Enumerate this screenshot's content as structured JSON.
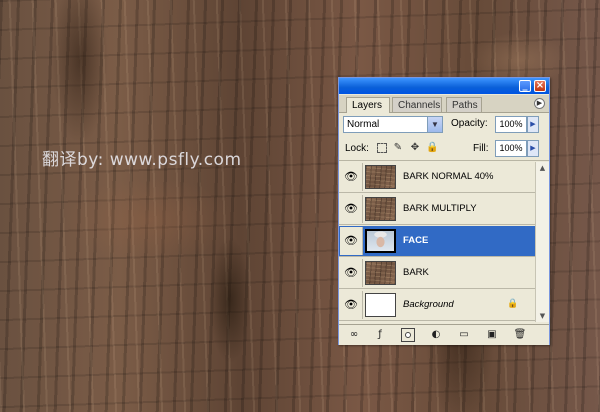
{
  "watermark": "翻译by: www.psfly.com",
  "panel": {
    "tabs": [
      "Layers",
      "Channels",
      "Paths"
    ],
    "blend_mode": "Normal",
    "opacity_label": "Opacity:",
    "opacity_value": "100%",
    "lock_label": "Lock:",
    "fill_label": "Fill:",
    "fill_value": "100%",
    "layers": [
      {
        "name": "BARK NORMAL 40%",
        "visible": true,
        "selected": false,
        "thumbnail": "bark"
      },
      {
        "name": "BARK MULTIPLY",
        "visible": true,
        "selected": false,
        "thumbnail": "bark"
      },
      {
        "name": "FACE",
        "visible": true,
        "selected": true,
        "thumbnail": "face"
      },
      {
        "name": "BARK",
        "visible": true,
        "selected": false,
        "thumbnail": "bark"
      },
      {
        "name": "Background",
        "visible": true,
        "selected": false,
        "thumbnail": "white",
        "locked": true
      }
    ],
    "icons": {
      "eye": "👁",
      "link": "∞",
      "fx": "ƒ",
      "half_circle": "◐",
      "folder": "▭",
      "new_layer": "▣",
      "trash": "🗑",
      "lock": "🔒",
      "brush": "✎",
      "move": "✥",
      "arrow_right": "▶",
      "arrow_down": "▼",
      "arrow_up": "▲"
    }
  }
}
